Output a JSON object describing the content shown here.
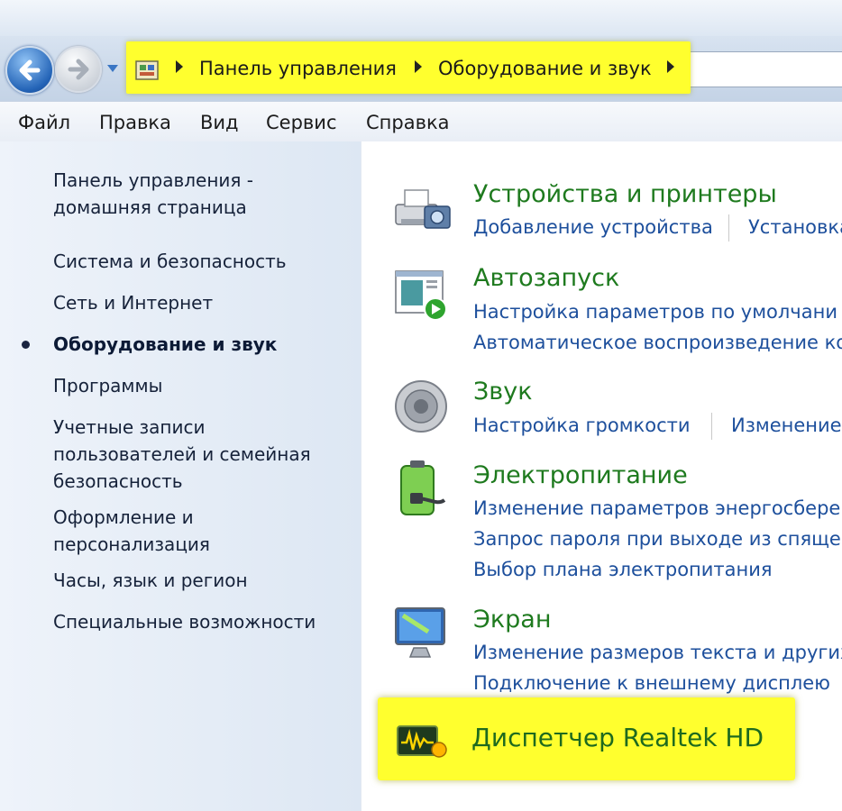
{
  "address_bar": {
    "crumbs": [
      "Панель управления",
      "Оборудование и звук"
    ]
  },
  "menu": [
    "Файл",
    "Правка",
    "Вид",
    "Сервис",
    "Справка"
  ],
  "sidebar": {
    "home_line1": "Панель управления -",
    "home_line2": "домашняя страница",
    "items": [
      {
        "lines": [
          "Система и безопасность"
        ]
      },
      {
        "lines": [
          "Сеть и Интернет"
        ]
      },
      {
        "lines": [
          "Оборудование и звук"
        ],
        "active": true
      },
      {
        "lines": [
          "Программы"
        ]
      },
      {
        "lines": [
          "Учетные записи",
          "пользователей и семейная",
          "безопасность"
        ]
      },
      {
        "lines": [
          "Оформление и",
          "персонализация"
        ]
      },
      {
        "lines": [
          "Часы, язык и регион"
        ]
      },
      {
        "lines": [
          "Специальные возможности"
        ]
      }
    ]
  },
  "categories": [
    {
      "title": "Устройства и принтеры",
      "icon": "printer-camera-icon",
      "links": [
        "Добавление устройства",
        "Установка"
      ]
    },
    {
      "title": "Автозапуск",
      "icon": "autoplay-icon",
      "links": [
        "Настройка параметров по умолчани",
        "Автоматическое воспроизведение ко"
      ]
    },
    {
      "title": "Звук",
      "icon": "speaker-icon",
      "links": [
        "Настройка громкости",
        "Изменение"
      ]
    },
    {
      "title": "Электропитание",
      "icon": "battery-plug-icon",
      "links": [
        "Изменение параметров энергосберег",
        "Запрос пароля при выходе из спящег",
        "Выбор плана электропитания"
      ]
    },
    {
      "title": "Экран",
      "icon": "monitor-icon",
      "links": [
        "Изменение размеров текста и других",
        "Подключение к внешнему дисплею"
      ]
    }
  ],
  "realtek": {
    "title": "Диспетчер Realtek HD",
    "icon": "realtek-audio-icon"
  },
  "colors": {
    "highlight": "#ffff2e",
    "category_title": "#1e7a1e",
    "link": "#1d4f9c"
  }
}
